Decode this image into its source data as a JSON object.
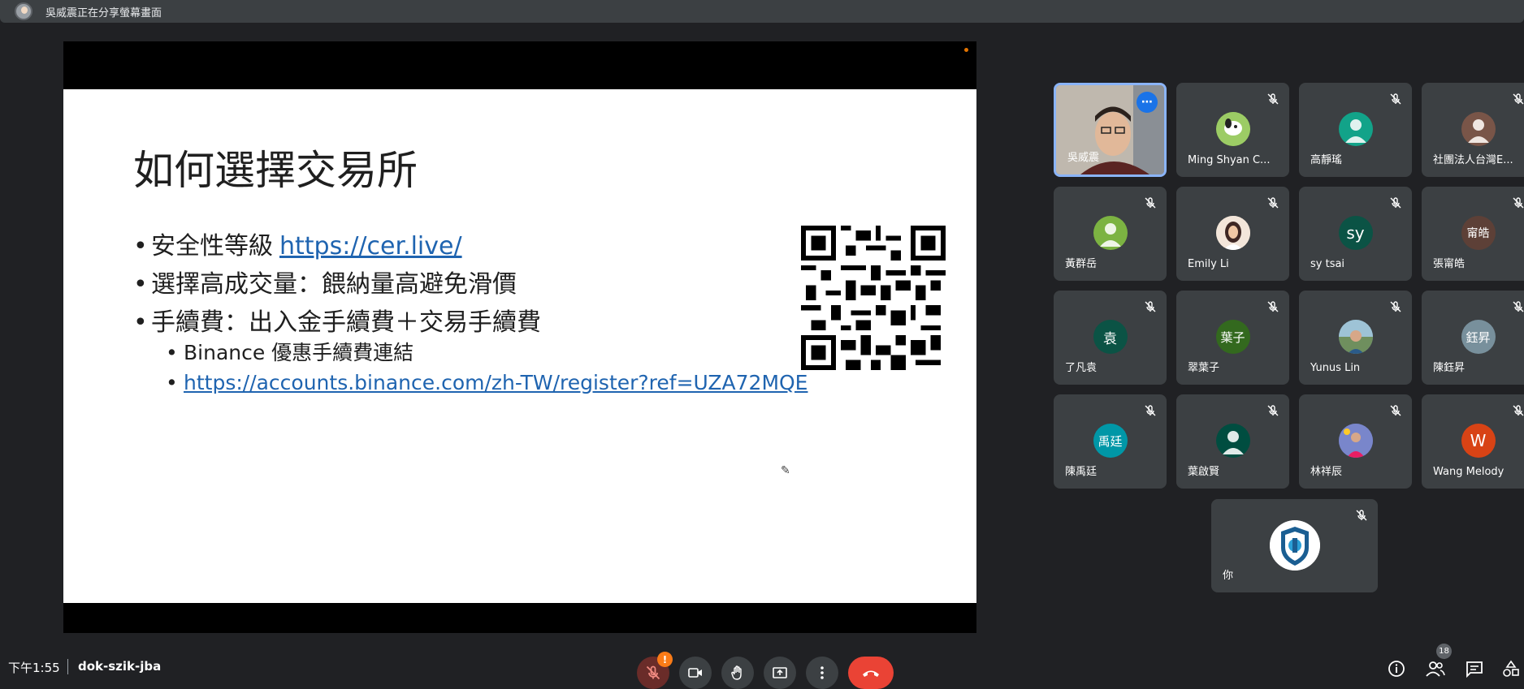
{
  "top_bar": {
    "sharing_text": "吳威震正在分享螢幕畫面"
  },
  "slide": {
    "title": "如何選擇交易所",
    "bullets": [
      {
        "text": "安全性等級",
        "link": "https://cer.live/"
      },
      {
        "text": "選擇高成交量：餵納量高避免滑價"
      },
      {
        "text": "手續費：出入金手續費＋交易手續費"
      }
    ],
    "sub_bullets": [
      {
        "text": "Binance 優惠手續費連結"
      },
      {
        "link": "https://accounts.binance.com/zh-TW/register?ref=UZA72MQE"
      }
    ]
  },
  "participants": [
    {
      "name": "吳威震",
      "initial": "",
      "color": "#6b4d3c"
    },
    {
      "name": "Ming Shyan C...",
      "initial": "",
      "color": "#8bc34a"
    },
    {
      "name": "高靜瑤",
      "initial": "",
      "color": "#12a389"
    },
    {
      "name": "社團法人台灣E...",
      "initial": "",
      "color": "#795548"
    },
    {
      "name": "黃群岳",
      "initial": "",
      "color": "#7cb342"
    },
    {
      "name": "Emily Li",
      "initial": "",
      "color": "#c9a58c"
    },
    {
      "name": "sy tsai",
      "initial": "sy",
      "color": "#0b5345"
    },
    {
      "name": "張甯皓",
      "initial": "甯皓",
      "color": "#5d4037"
    },
    {
      "name": "了凡袁",
      "initial": "袁",
      "color": "#0b5345"
    },
    {
      "name": "翠葉子",
      "initial": "葉子",
      "color": "#33691e"
    },
    {
      "name": "Yunus Lin",
      "initial": "",
      "color": "#7aa3b8"
    },
    {
      "name": "陳鈺昇",
      "initial": "鈺昇",
      "color": "#78909c"
    },
    {
      "name": "陳禹廷",
      "initial": "禹廷",
      "color": "#0097a7"
    },
    {
      "name": "葉啟賢",
      "initial": "",
      "color": "#004d40"
    },
    {
      "name": "林祥辰",
      "initial": "",
      "color": "#5c6bc0"
    },
    {
      "name": "Wang Melody",
      "initial": "W",
      "color": "#d84315"
    },
    {
      "name": "你",
      "initial": "",
      "color": "#ffffff"
    }
  ],
  "bottom_bar": {
    "time": "下午1:55",
    "meeting_code": "dok-szik-jba",
    "mic_warning": "!",
    "participant_count": "18"
  }
}
